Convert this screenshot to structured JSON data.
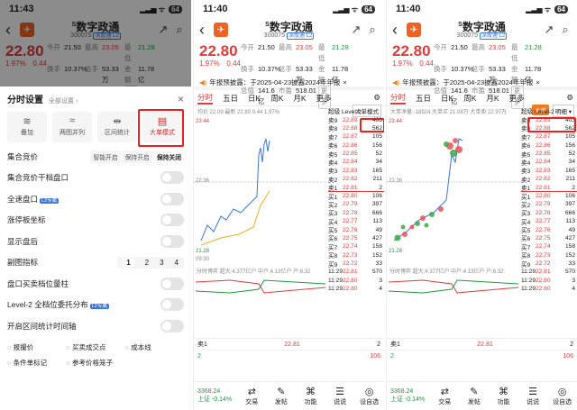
{
  "stock": {
    "name": "数字政通",
    "superscript": "S",
    "code": "300075",
    "exchange_tag": "深股通 L2",
    "price": "22.80",
    "pct": "1.97%",
    "chg": "0.44",
    "fields": [
      [
        "今开",
        "21.50",
        "最高",
        "23.05",
        "最低",
        "21.28"
      ],
      [
        "换手",
        "10.37%",
        "总手",
        "53.33万",
        "金额",
        "11.78亿"
      ],
      [
        "总值",
        "141.6亿",
        "市盈",
        "518.01",
        "更多",
        ""
      ]
    ]
  },
  "p1": {
    "time": "11:43",
    "panel_title": "分时设置",
    "panel_sub": "全部设置 ›",
    "close": "×",
    "modes": [
      {
        "icon": "≋",
        "label": "叠加"
      },
      {
        "icon": "≈",
        "label": "两图并列"
      },
      {
        "icon": "⇹",
        "label": "区间统计"
      },
      {
        "icon": "▤",
        "label": "大单模式"
      }
    ],
    "auction_label": "集合竞价",
    "auction_opts": [
      "智能开启",
      "保持开启",
      "保持关闭"
    ],
    "rows": [
      {
        "label": "集合竞价干档盘口",
        "tag": ""
      },
      {
        "label": "全速盘口",
        "tag": "L2专属"
      },
      {
        "label": "涨停板坐标",
        "tag": ""
      },
      {
        "label": "显示盘后",
        "tag": ""
      }
    ],
    "sub_label": "副图指标",
    "sub_nums": [
      "1",
      "2",
      "3",
      "4"
    ],
    "rows2": [
      {
        "label": "盘口买卖档位量柱",
        "tag": ""
      },
      {
        "label": "Level-2 全档位委托分布",
        "tag": "L2专属"
      },
      {
        "label": "开启区间统计时间轴",
        "tag": ""
      }
    ],
    "checks": [
      "报撮价",
      "买卖成交点",
      "成本线",
      "条件单标记",
      "参考价格笼子"
    ]
  },
  "p2": {
    "time": "11:40",
    "notice": "年报预披露：于2025-04-23披露2024年年报",
    "tabs": [
      "分时",
      "五日",
      "日K",
      "周K",
      "月K",
      "更多"
    ],
    "mode_btn": "大单模式",
    "legend": "均价 22.09  最新 22.80  0.44  1.97%",
    "hi": "23.44",
    "lo": "21.28",
    "mid": "22.36",
    "hi_pct": "4.83%",
    "lo_pct": "-4.83%",
    "start": "09:30",
    "end": "15:00",
    "level": "超级 Level-2",
    "sub_legend": "分时博弈  超大:4.377亿户 中户:4.13亿户 户:6.32",
    "sub_vals": [
      "0.372",
      "-0.632"
    ]
  },
  "p3": {
    "time": "11:40",
    "mode_badge": "大单",
    "mode_btn2": "明细 ▾",
    "legend": "大单净量 -18924  大单买 21.08万 大单卖 22.97万"
  },
  "orderbook": [
    [
      "卖9",
      "22.89",
      "403"
    ],
    [
      "卖8",
      "22.88",
      "562"
    ],
    [
      "卖7",
      "22.87",
      "105"
    ],
    [
      "卖6",
      "22.86",
      "156"
    ],
    [
      "卖5",
      "22.85",
      "52"
    ],
    [
      "卖4",
      "22.84",
      "34"
    ],
    [
      "卖3",
      "22.83",
      "165"
    ],
    [
      "卖2",
      "22.82",
      "211"
    ],
    [
      "卖1",
      "22.81",
      "2"
    ],
    [
      "买1",
      "22.80",
      "106"
    ],
    [
      "买2",
      "22.79",
      "397"
    ],
    [
      "买3",
      "22.78",
      "666"
    ],
    [
      "买4",
      "22.77",
      "113"
    ],
    [
      "买5",
      "22.76",
      "49"
    ],
    [
      "买6",
      "22.75",
      "427"
    ],
    [
      "买7",
      "22.74",
      "158"
    ],
    [
      "买8",
      "22.73",
      "152"
    ],
    [
      "买9",
      "22.72",
      "33"
    ]
  ],
  "trades": [
    [
      "11:29",
      "22.81",
      "570"
    ],
    [
      "11:29",
      "22.80",
      "3"
    ],
    [
      "11:29",
      "22.80",
      "4"
    ]
  ],
  "bottom": {
    "index_val": "3368.24",
    "index_lbl": "上证 -0.14%",
    "items": [
      {
        "icon": "⇄",
        "label": "交易"
      },
      {
        "icon": "✎",
        "label": "发帖"
      },
      {
        "icon": "⌘",
        "label": "功能"
      },
      {
        "icon": "☰",
        "label": "说说"
      },
      {
        "icon": "◎",
        "label": "设自选"
      }
    ]
  }
}
